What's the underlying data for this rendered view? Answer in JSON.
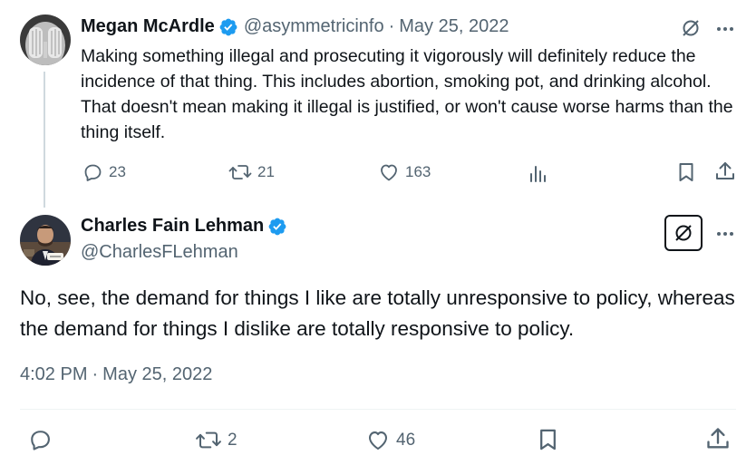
{
  "parent_tweet": {
    "author_name": "Megan McArdle",
    "handle": "@asymmetricinfo",
    "separator": "·",
    "date": "May 25, 2022",
    "text": "Making something illegal and prosecuting it vigorously will definitely reduce the incidence of that thing. This includes abortion, smoking pot, and drinking alcohol. That doesn't mean making it illegal is justified, or won't cause worse harms than the thing itself.",
    "replies": "23",
    "retweets": "21",
    "likes": "163"
  },
  "main_tweet": {
    "author_name": "Charles Fain Lehman",
    "handle": "@CharlesFLehman",
    "text": "No, see, the demand for things I like are totally unresponsive to policy, whereas the demand for things I dislike are totally responsive to policy.",
    "time": "4:02 PM",
    "separator": "·",
    "date": "May 25, 2022",
    "retweets": "2",
    "likes": "46"
  },
  "colors": {
    "text": "#0f1419",
    "muted": "#536471",
    "verified": "#1d9bf0",
    "thread_line": "#cfd9de",
    "divider": "#eff3f4"
  },
  "icons": [
    "verified-badge-icon",
    "grok-icon",
    "more-icon",
    "reply-icon",
    "retweet-icon",
    "like-icon",
    "views-icon",
    "bookmark-icon",
    "share-icon"
  ]
}
